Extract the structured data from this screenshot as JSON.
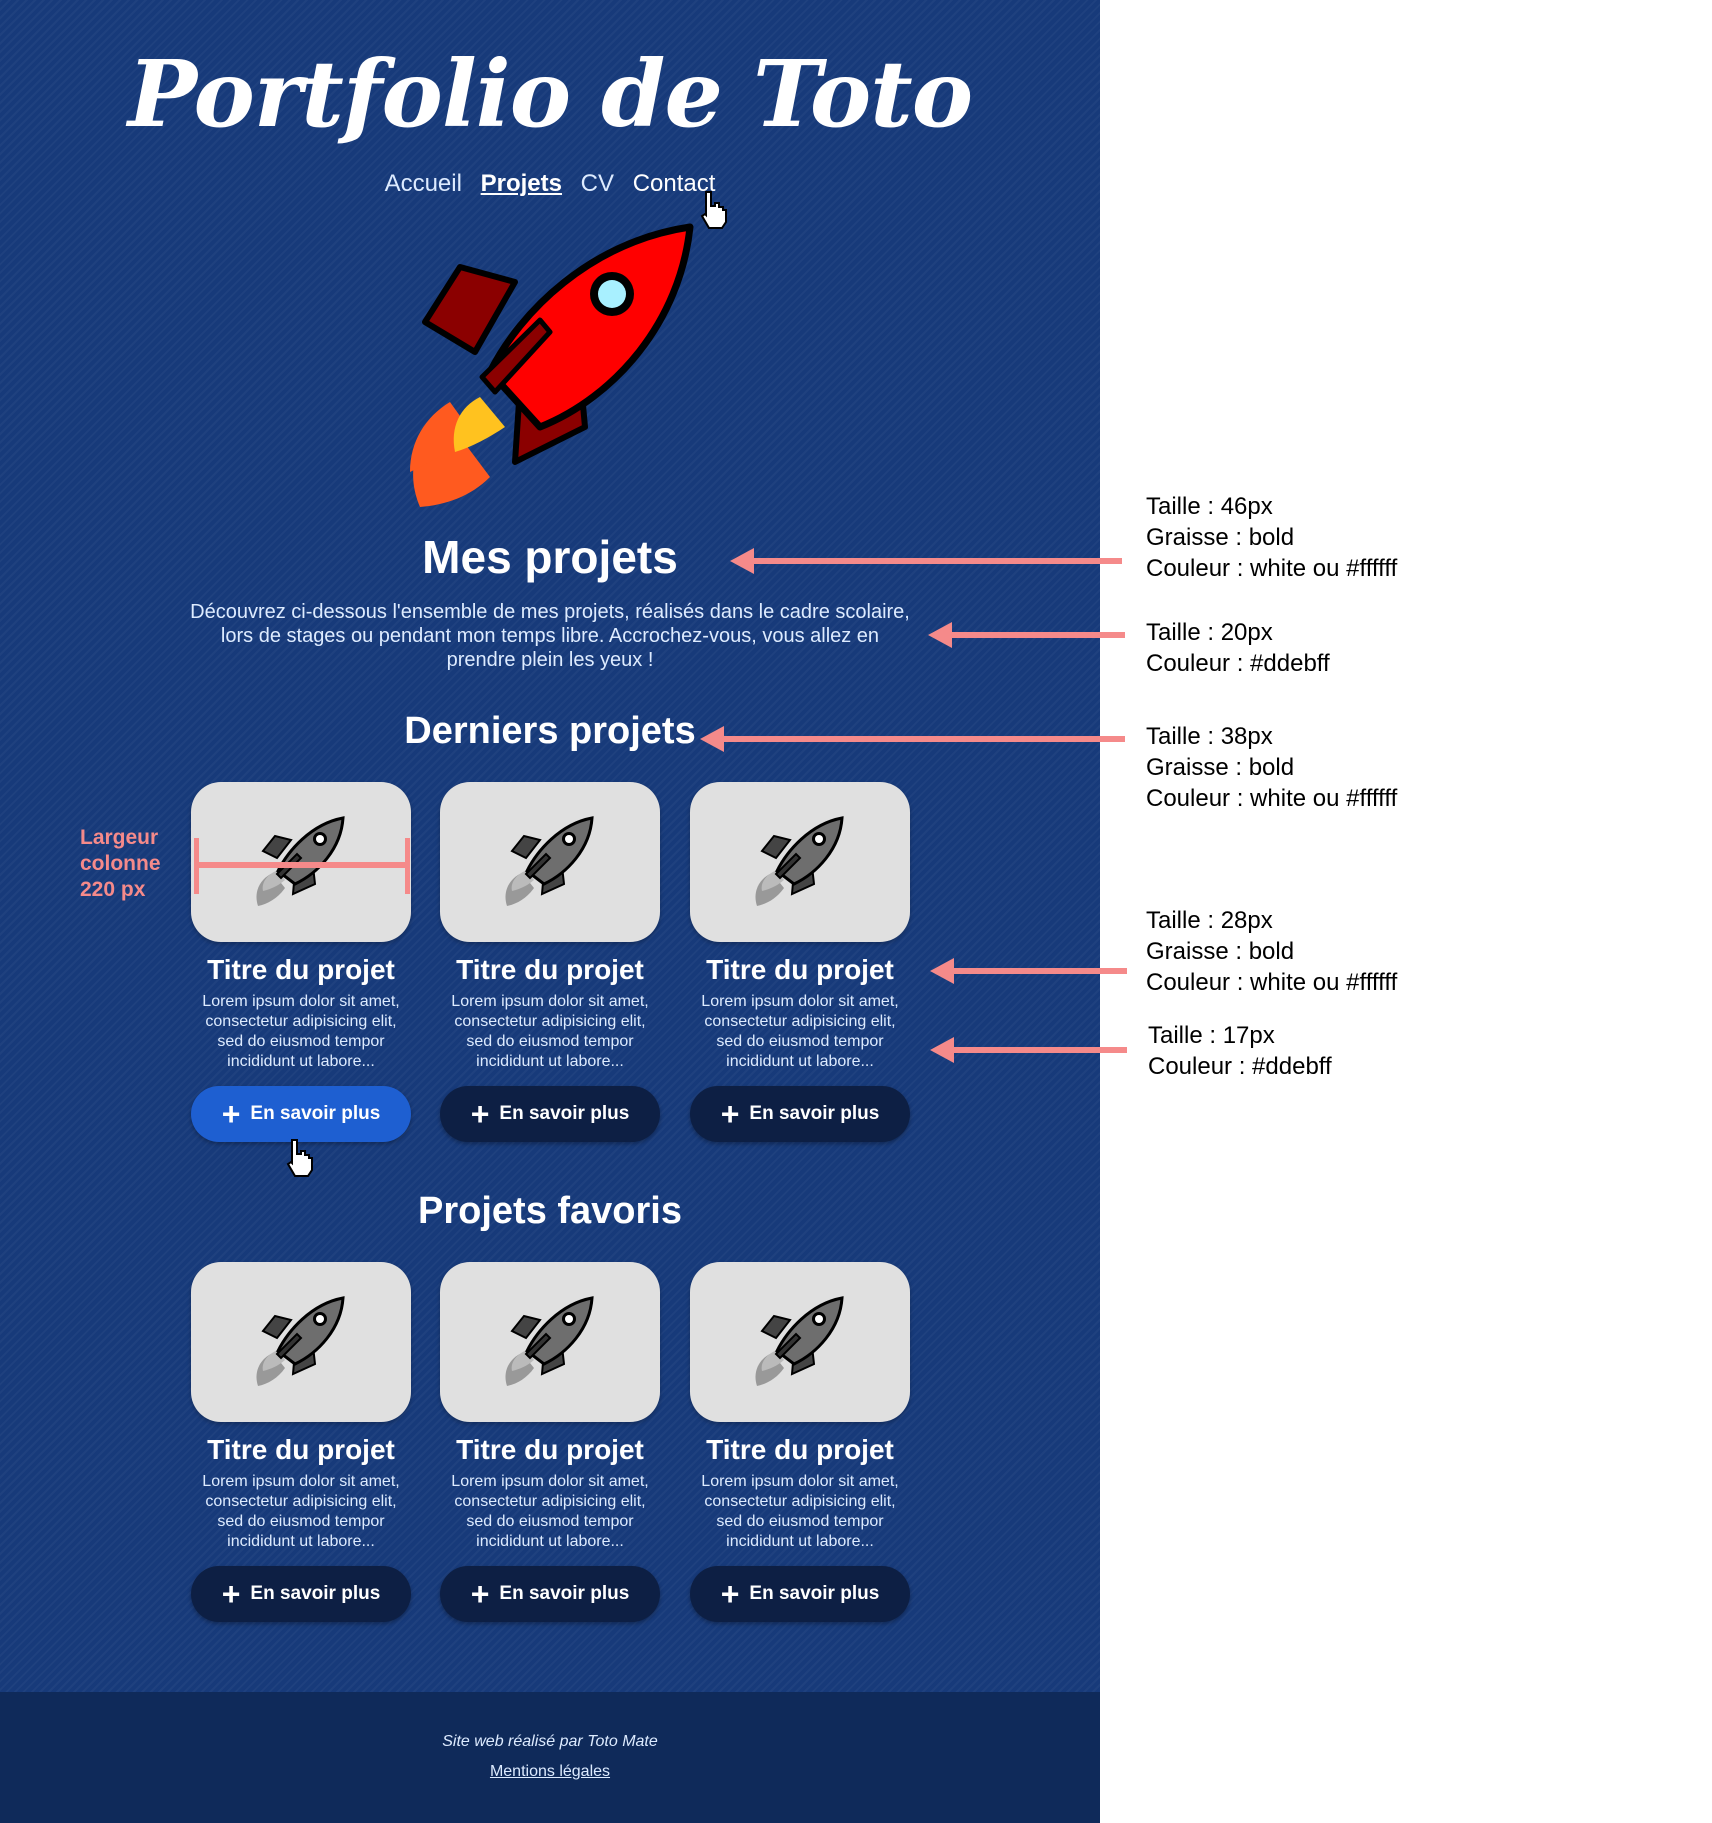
{
  "site": {
    "logo": "Portfolio de Toto",
    "nav": [
      {
        "label": "Accueil",
        "state": "normal"
      },
      {
        "label": "Projets",
        "state": "active"
      },
      {
        "label": "CV",
        "state": "normal"
      },
      {
        "label": "Contact",
        "state": "hover"
      }
    ],
    "main_title": "Mes projets",
    "intro": "Découvrez ci-dessous l'ensemble de mes projets, réalisés dans le cadre scolaire, lors de stages ou pendant mon temps libre. Accrochez-vous, vous allez en prendre plein les yeux !",
    "sections": [
      {
        "title": "Derniers projets",
        "cards": [
          {
            "title": "Titre du projet",
            "desc": "Lorem ipsum dolor sit amet, consectetur adipisicing elit, sed do eiusmod tempor incididunt ut labore...",
            "button": "En savoir plus",
            "state": "hover"
          },
          {
            "title": "Titre du projet",
            "desc": "Lorem ipsum dolor sit amet, consectetur adipisicing elit, sed do eiusmod tempor incididunt ut labore...",
            "button": "En savoir plus",
            "state": "normal"
          },
          {
            "title": "Titre du projet",
            "desc": "Lorem ipsum dolor sit amet, consectetur adipisicing elit, sed do eiusmod tempor incididunt ut labore...",
            "button": "En savoir plus",
            "state": "normal"
          }
        ]
      },
      {
        "title": "Projets favoris",
        "cards": [
          {
            "title": "Titre du projet",
            "desc": "Lorem ipsum dolor sit amet, consectetur adipisicing elit, sed do eiusmod tempor incididunt ut labore...",
            "button": "En savoir plus",
            "state": "normal"
          },
          {
            "title": "Titre du projet",
            "desc": "Lorem ipsum dolor sit amet, consectetur adipisicing elit, sed do eiusmod tempor incididunt ut labore...",
            "button": "En savoir plus",
            "state": "normal"
          },
          {
            "title": "Titre du projet",
            "desc": "Lorem ipsum dolor sit amet, consectetur adipisicing elit, sed do eiusmod tempor incididunt ut labore...",
            "button": "En savoir plus",
            "state": "normal"
          }
        ]
      }
    ],
    "footer": {
      "credit": "Site web réalisé par Toto Mate",
      "legal": "Mentions légales"
    }
  },
  "annotations": {
    "main_title": [
      "Taille : 46px",
      "Graisse : bold",
      "Couleur : white ou #ffffff"
    ],
    "intro": [
      "Taille : 20px",
      "Couleur : #ddebff"
    ],
    "section_title": [
      "Taille : 38px",
      "Graisse : bold",
      "Couleur : white ou #ffffff"
    ],
    "card_title": [
      "Taille : 28px",
      "Graisse : bold",
      "Couleur : white ou #ffffff"
    ],
    "card_desc": [
      "Taille : 17px",
      "Couleur : #ddebff"
    ],
    "column_width": [
      "Largeur",
      "colonne",
      "220 px"
    ]
  },
  "colors": {
    "background": "#173a7a",
    "footer": "#0f2a5a",
    "button": "#0d1f44",
    "button_hover": "#1e5fd1",
    "text_light": "#ddebff",
    "annotation_accent": "#f58a8a"
  },
  "icons": {
    "hero": "rocket-icon",
    "card": "rocket-icon",
    "button": "plus-icon",
    "cursor": "hand-pointer-icon"
  }
}
